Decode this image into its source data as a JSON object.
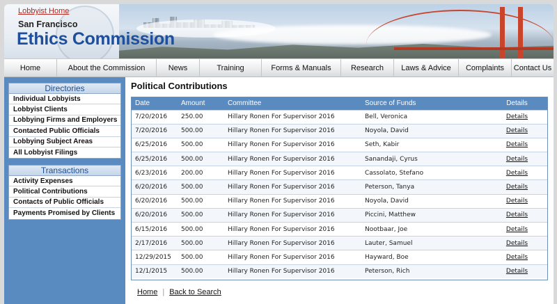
{
  "brand": {
    "home_link": "Lobbyist Home",
    "city": "San Francisco",
    "title": "Ethics Commission"
  },
  "nav": [
    {
      "label": "Home"
    },
    {
      "label": "About the Commission"
    },
    {
      "label": "News"
    },
    {
      "label": "Training"
    },
    {
      "label": "Forms & Manuals"
    },
    {
      "label": "Research"
    },
    {
      "label": "Laws & Advice"
    },
    {
      "label": "Complaints"
    },
    {
      "label": "Contact Us"
    }
  ],
  "sidebar": {
    "directories": {
      "title": "Directories",
      "items": [
        {
          "label": "Individual Lobbyists"
        },
        {
          "label": "Lobbyist Clients"
        },
        {
          "label": "Lobbying Firms and Employers"
        },
        {
          "label": "Contacted Public Officials"
        },
        {
          "label": "Lobbying Subject Areas"
        },
        {
          "label": "All Lobbyist Filings"
        }
      ]
    },
    "transactions": {
      "title": "Transactions",
      "items": [
        {
          "label": "Activity Expenses"
        },
        {
          "label": "Political Contributions"
        },
        {
          "label": "Contacts of Public Officials"
        },
        {
          "label": "Payments Promised by Clients"
        }
      ]
    }
  },
  "main": {
    "title": "Political Contributions",
    "columns": [
      "Date",
      "Amount",
      "Committee",
      "Source of Funds",
      "Details"
    ],
    "rows": [
      {
        "date": "7/20/2016",
        "amount": "250.00",
        "committee": "Hillary Ronen For Supervisor 2016",
        "source": "Bell, Veronica",
        "details": "Details"
      },
      {
        "date": "7/20/2016",
        "amount": "500.00",
        "committee": "Hillary Ronen For Supervisor 2016",
        "source": "Noyola, David",
        "details": "Details"
      },
      {
        "date": "6/25/2016",
        "amount": "500.00",
        "committee": "Hillary Ronen For Supervisor 2016",
        "source": "Seth, Kabir",
        "details": "Details"
      },
      {
        "date": "6/25/2016",
        "amount": "500.00",
        "committee": "Hillary Ronen For Supervisor 2016",
        "source": "Sanandaji, Cyrus",
        "details": "Details"
      },
      {
        "date": "6/23/2016",
        "amount": "200.00",
        "committee": "Hillary Ronen For Supervisor 2016",
        "source": "Cassolato, Stefano",
        "details": "Details"
      },
      {
        "date": "6/20/2016",
        "amount": "500.00",
        "committee": "Hillary Ronen For Supervisor 2016",
        "source": "Peterson, Tanya",
        "details": "Details"
      },
      {
        "date": "6/20/2016",
        "amount": "500.00",
        "committee": "Hillary Ronen For Supervisor 2016",
        "source": "Noyola, David",
        "details": "Details"
      },
      {
        "date": "6/20/2016",
        "amount": "500.00",
        "committee": "Hillary Ronen For Supervisor 2016",
        "source": "Piccini, Matthew",
        "details": "Details"
      },
      {
        "date": "6/15/2016",
        "amount": "500.00",
        "committee": "Hillary Ronen For Supervisor 2016",
        "source": "Nootbaar, Joe",
        "details": "Details"
      },
      {
        "date": "2/17/2016",
        "amount": "500.00",
        "committee": "Hillary Ronen For Supervisor 2016",
        "source": "Lauter, Samuel",
        "details": "Details"
      },
      {
        "date": "12/29/2015",
        "amount": "500.00",
        "committee": "Hillary Ronen For Supervisor 2016",
        "source": "Hayward, Boe",
        "details": "Details"
      },
      {
        "date": "12/1/2015",
        "amount": "500.00",
        "committee": "Hillary Ronen For Supervisor 2016",
        "source": "Peterson, Rich",
        "details": "Details"
      }
    ],
    "footer": {
      "home": "Home",
      "separator": "|",
      "back": "Back to Search"
    }
  },
  "colors": {
    "brand_blue": "#1d4f9c",
    "header_blue": "#5a8bc0",
    "home_link_red": "#b5261e",
    "bridge_red": "#c8442b"
  }
}
